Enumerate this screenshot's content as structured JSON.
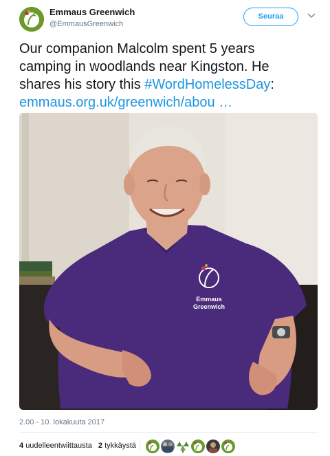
{
  "account": {
    "name": "Emmaus Greenwich",
    "handle": "@EmmausGreenwich",
    "follow_label": "Seuraa",
    "avatar_color": "#6a9a2a"
  },
  "tweet": {
    "line1": "Our companion Malcolm spent 5 years",
    "line2": "camping in woodlands near Kingston. He",
    "line3_prefix": "shares his story this ",
    "hashtag": "#WordHomelessDay",
    "line3_suffix": ":",
    "url": "emmaus.org.uk/greenwich/abou …"
  },
  "photo": {
    "shirt_logo_line1": "Emmaus",
    "shirt_logo_line2": "Greenwich",
    "shirt_color": "#4a2a7a"
  },
  "timestamp": "2.00 - 10. lokakuuta 2017",
  "stats": {
    "retweets_count": "4",
    "retweets_label": "uudelleentwiittausta",
    "likes_count": "2",
    "likes_label": "tykkäystä"
  },
  "likers": [
    {
      "icon": "emmaus-logo",
      "color": "#6a9a2a"
    },
    {
      "icon": "photo-avatar",
      "color": "#5a6e8c"
    },
    {
      "icon": "tree-avatar",
      "color": "#4f8a3a"
    },
    {
      "icon": "emmaus-logo",
      "color": "#6a9a2a"
    },
    {
      "icon": "photo-avatar",
      "color": "#8a4a3a"
    },
    {
      "icon": "emmaus-logo",
      "color": "#6a9a2a"
    }
  ],
  "colors": {
    "link": "#1b95e0",
    "follow": "#1da1f2",
    "muted": "#657786"
  }
}
